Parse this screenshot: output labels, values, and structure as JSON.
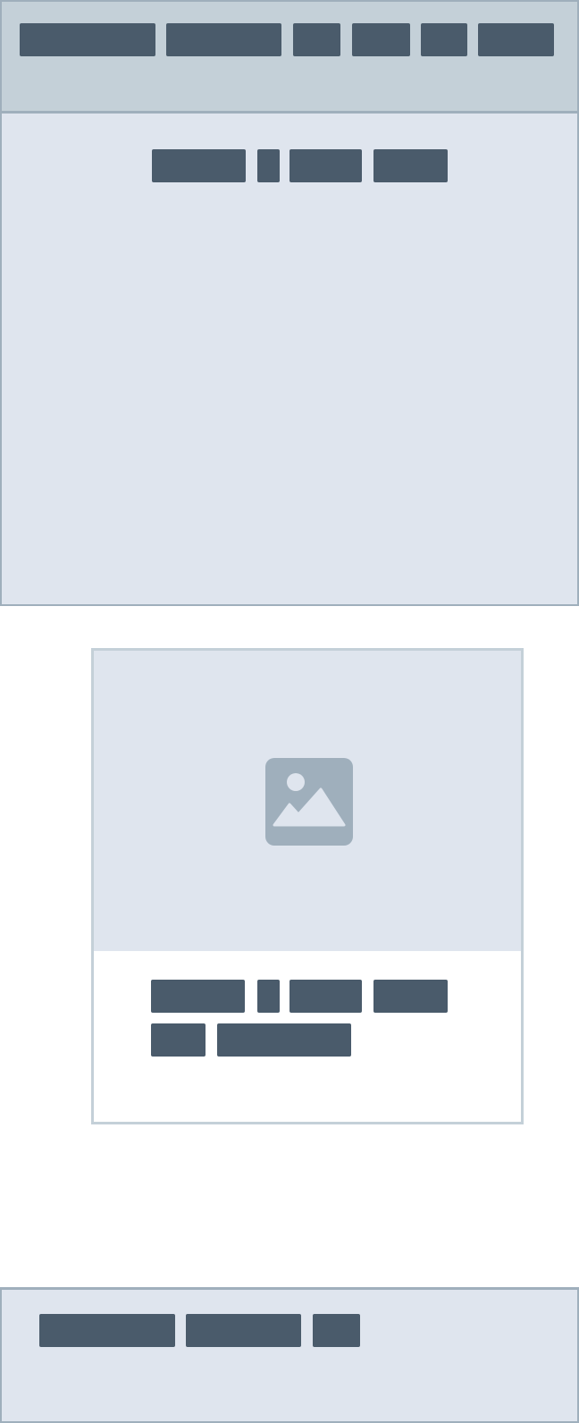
{
  "header": {
    "nav_items": [
      "",
      "",
      "",
      "",
      "",
      ""
    ]
  },
  "hero": {
    "headline_words": [
      "",
      "",
      "",
      ""
    ]
  },
  "card": {
    "image_icon": "image-icon",
    "title_line1_words": [
      "",
      "",
      "",
      ""
    ],
    "title_line2_words": [
      "",
      ""
    ]
  },
  "footer": {
    "links": [
      "",
      "",
      ""
    ]
  },
  "colors": {
    "placeholder_block": "#4a5b6b",
    "header_bg": "#c4d0d8",
    "section_bg": "#dfe5ee",
    "border": "#9fafbc",
    "icon": "#9fafbc"
  }
}
